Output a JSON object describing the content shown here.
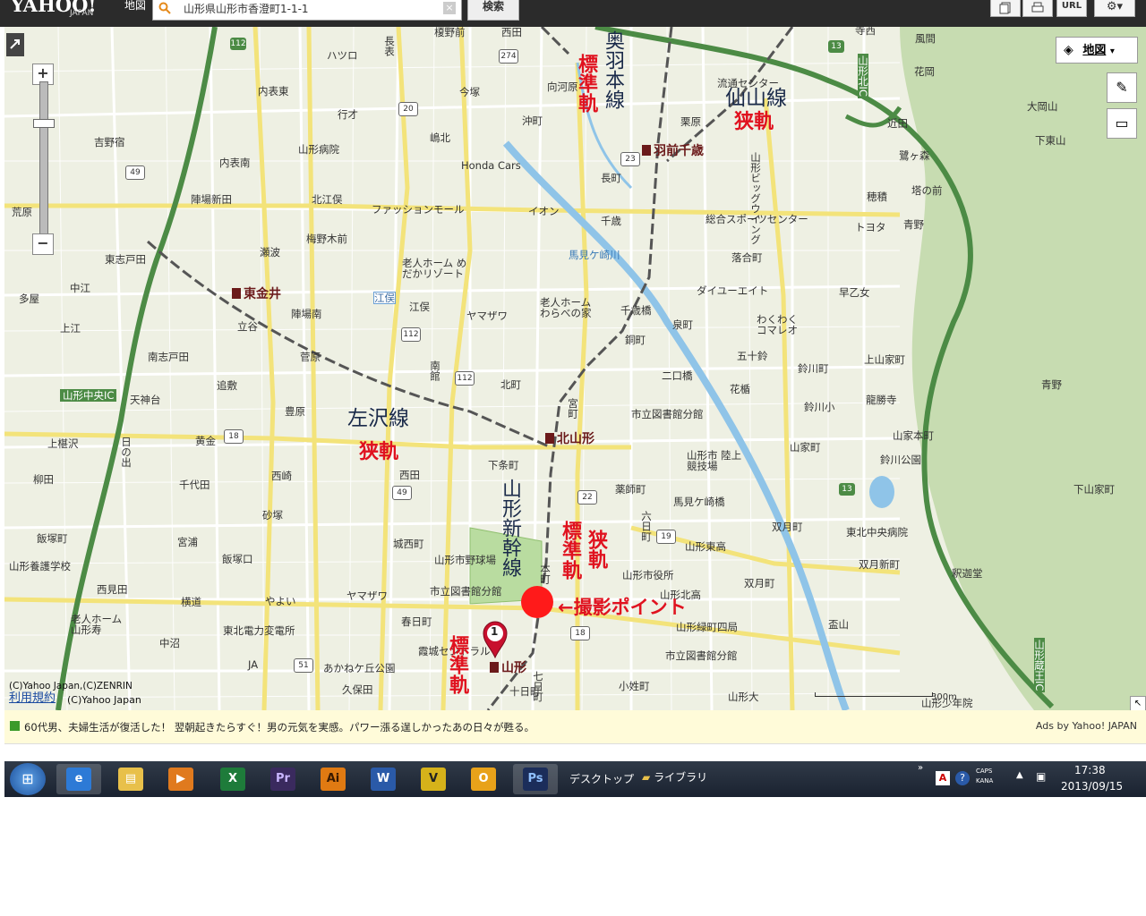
{
  "header": {
    "logo_text": "YAHOO!",
    "logo_sub": "JAPAN",
    "section_label": "地図",
    "search_value": "山形県山形市香澄町1-1-1",
    "clear_label": "×",
    "search_button": "検索",
    "url_button": "URL"
  },
  "map": {
    "type_button": "地図",
    "copyright": "(C)Yahoo Japan,(C)ZENRIN",
    "terms": "利用規約",
    "copyright2": "(C)Yahoo Japan",
    "scale": "300m",
    "annotation_shoot": "←撮影ポイント",
    "pin_number": "1",
    "lines": {
      "ou_main": "奥羽本線",
      "senzan": "仙山線",
      "sasazawa": "左沢線",
      "shinkansen": "山形新幹線",
      "standard": "標準軌",
      "narrow": "狭軌"
    },
    "stations": [
      "羽前千歳",
      "東金井",
      "北山形",
      "山形"
    ],
    "places": {
      "p1": "榎野前",
      "p2": "西田",
      "p3": "ハツロ",
      "p4": "長表",
      "p5": "内表東",
      "p6": "今塚",
      "p7": "行才",
      "p8": "吉野宿",
      "p9": "内表南",
      "p10": "陣場新田",
      "p11": "山形病院",
      "p12": "北江俣",
      "p13": "Honda Cars",
      "p14": "ファッションモール",
      "p15": "イオン",
      "p16": "千歳",
      "p17": "総合スポーツセンター",
      "p18": "トヨタ",
      "p19": "梅野木前",
      "p20": "瀬波",
      "p21": "東志戸田",
      "p22": "中江",
      "p23": "多屋",
      "p24": "陣場南",
      "p25": "老人ホーム めだかリゾート",
      "p26": "江俣",
      "p27": "ヤマザワ",
      "p28": "老人ホーム わらべの家",
      "p29": "千歳橋",
      "p30": "泉町",
      "p31": "落合町",
      "p32": "ダイユーエイト",
      "p33": "わくわく コマレオ",
      "p34": "上江",
      "p35": "立谷",
      "p36": "南志戸田",
      "p37": "菅原",
      "p38": "北町",
      "p39": "二口橋",
      "p40": "五十鈴",
      "p41": "鈴川町",
      "p42": "上山家町",
      "p43": "青野",
      "p44": "花楯",
      "p45": "追敷",
      "p46": "豊原",
      "p47": "市立図書館分館",
      "p48": "鈴川小",
      "p49": "龍勝寺",
      "p50": "上椹沢",
      "p51": "黄金",
      "p52": "西田",
      "p53": "下条町",
      "p54": "山家町",
      "p55": "山家本町",
      "p56": "鈴川公園",
      "p57": "柳田",
      "p58": "千代田",
      "p59": "西崎",
      "p60": "薬師町",
      "p61": "馬見ケ崎橋",
      "p62": "下山家町",
      "p63": "山形市 陸上競技場",
      "p64": "砂塚",
      "p65": "城西町",
      "p66": "双月町",
      "p67": "東北中央病院",
      "p68": "飯塚町",
      "p69": "宮浦",
      "p70": "山形東高",
      "p71": "飯塚口",
      "p72": "山形市野球場",
      "p73": "山形市役所",
      "p74": "双月新町",
      "p75": "釈迦堂",
      "p76": "山形養護学校",
      "p77": "西見田",
      "p78": "横道",
      "p79": "やよい",
      "p80": "ヤマザワ",
      "p81": "市立図書館分館",
      "p82": "山形北高",
      "p83": "双月町",
      "p84": "老人ホーム 山形寿",
      "p85": "東北電力変電所",
      "p86": "春日町",
      "p87": "山形緑町四局",
      "p88": "盃山",
      "p89": "中沼",
      "p90": "霞城セントラル",
      "p91": "市立図書館分館",
      "p92": "JA",
      "p93": "あかねケ丘公園",
      "p94": "久保田",
      "p95": "十日町",
      "p96": "小姓町",
      "p97": "山形大",
      "p98": "山形少年院",
      "p99": "山形中央IC",
      "p100": "天神台",
      "p101": "荒原",
      "p102": "山形北IC",
      "p103": "山形蔵王IC",
      "p104": "風間",
      "p105": "花岡",
      "p106": "大岡山",
      "p107": "近田",
      "p108": "下東山",
      "p109": "塔の前",
      "p110": "鷺ヶ森",
      "p111": "穂積",
      "p112": "青野",
      "p113": "早乙女",
      "p114": "流通センター",
      "p115": "馬見ケ崎川",
      "p116": "栗原",
      "p117": "長町",
      "p118": "山形ビッグウイング",
      "p119": "沖町",
      "p120": "向河原",
      "p121": "嶋北",
      "p122": "江俣",
      "p123": "銅町",
      "p124": "宮町",
      "p125": "六日町",
      "p126": "寺西",
      "p127": "南館",
      "p128": "日の出",
      "p129": "七日町",
      "p130": "本町"
    }
  },
  "ad": {
    "text": "60代男、夫婦生活が復活した！ 翌朝起きたらすぐ！男の元気を実感。パワー漲る逞しかったあの日々が甦る。",
    "source": "Ads by Yahoo! JAPAN"
  },
  "taskbar": {
    "desktop": "デスクトップ",
    "library": "ライブラリ",
    "time": "17:38",
    "date": "2013/09/15",
    "caps": "CAPS",
    "kana": "KANA",
    "apps": [
      "ie-icon",
      "explorer-icon",
      "media-player-icon",
      "excel-icon",
      "premiere-icon",
      "illustrator-icon",
      "word-icon",
      "vegas-icon",
      "outlook-icon",
      "photoshop-icon"
    ],
    "app_labels": {
      "excel": "X",
      "premiere": "Pr",
      "illustrator": "Ai",
      "word": "W",
      "photoshop": "Ps",
      "outlook": "O"
    }
  },
  "colors": {
    "map_bg": "#eef0e3",
    "expressway": "#4c8b45",
    "annotation_red": "#e0121f",
    "shoot_point": "#ff1a1a",
    "river": "#8fc4e8",
    "park": "#b9dca0",
    "mountain": "#c7dcb1"
  }
}
